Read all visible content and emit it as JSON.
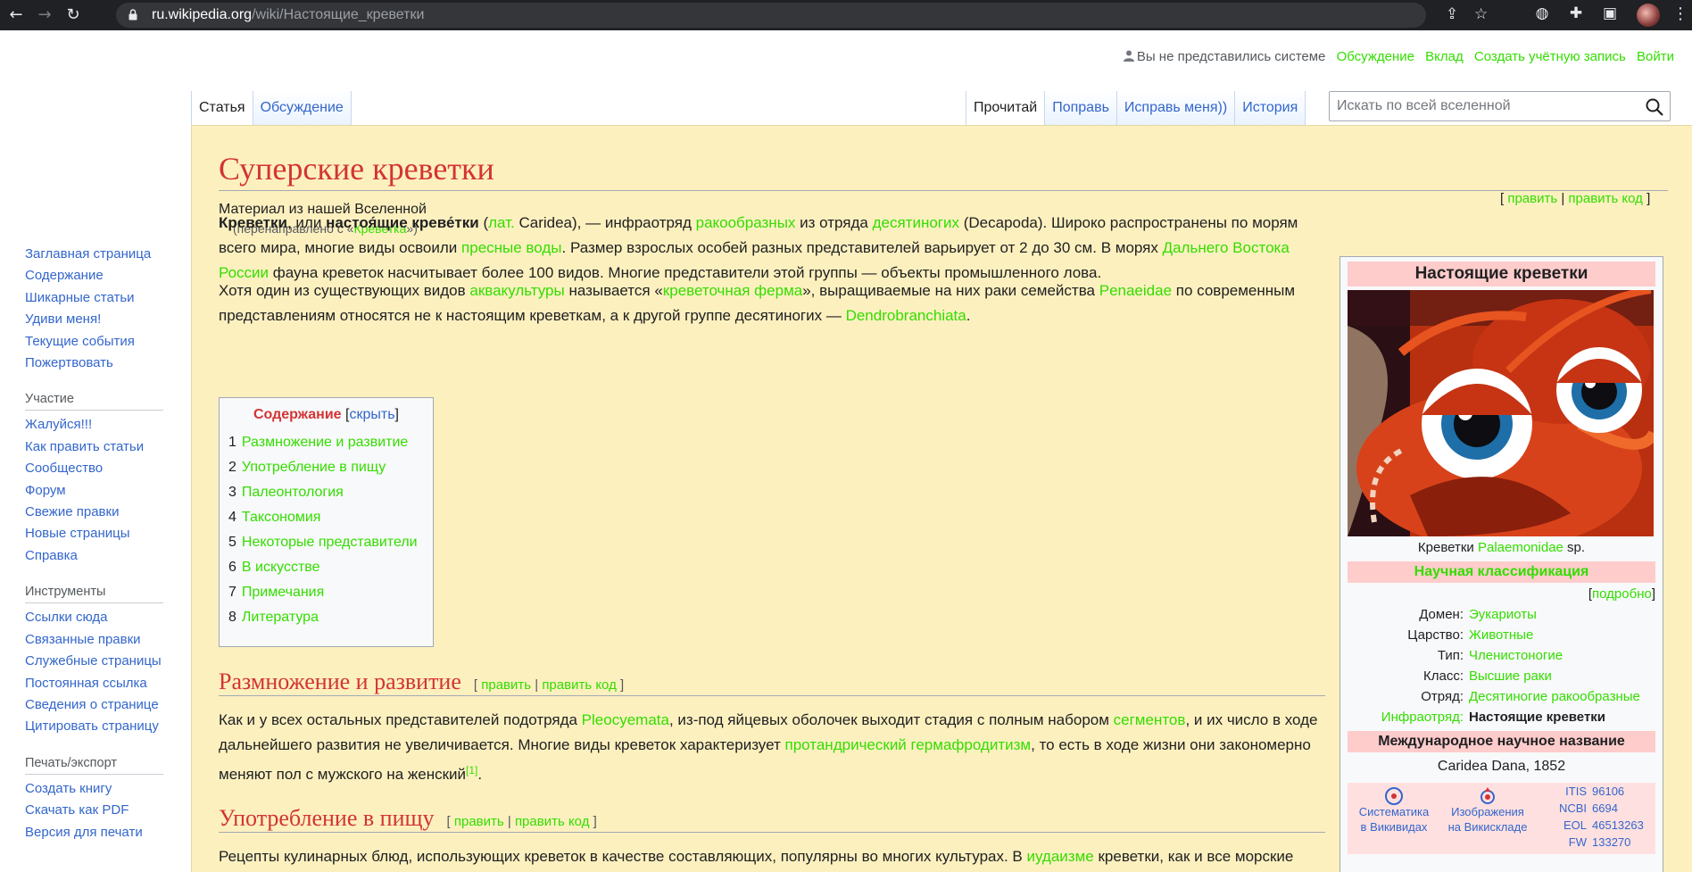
{
  "browser": {
    "url_host": "ru.wikipedia.org",
    "url_path": "/wiki/Настоящие_креветки"
  },
  "personal": {
    "user_status": "Вы не представились системе",
    "talk": "Обсуждение",
    "contributions": "Вклад",
    "create_account": "Создать учётную запись",
    "login": "Войти"
  },
  "tabs": {
    "article": "Статья",
    "talk": "Обсуждение",
    "read": "Прочитай",
    "edit": "Поправь",
    "edit_source": "Исправь меня))",
    "history": "История"
  },
  "search": {
    "placeholder": "Искать по всей вселенной"
  },
  "sidebar": {
    "main": [
      "Заглавная страница",
      "Содержание",
      "Шикарные статьи",
      "Удиви меня!",
      "Текущие события",
      "Пожертвовать"
    ],
    "participation_title": "Участие",
    "participation": [
      "Жалуйся!!!",
      "Как править статьи",
      "Сообщество",
      "Форум",
      "Свежие правки",
      "Новые страницы",
      "Справка"
    ],
    "tools_title": "Инструменты",
    "tools": [
      "Ссылки сюда",
      "Связанные правки",
      "Служебные страницы",
      "Постоянная ссылка",
      "Сведения о странице",
      "Цитировать страницу"
    ],
    "print_title": "Печать/экспорт",
    "print": [
      "Создать книгу",
      "Скачать как PDF",
      "Версия для печати"
    ]
  },
  "article": {
    "title": "Суперские креветки",
    "sitesub": "Материал из нашей Вселенной",
    "redirect_prefix": "(перенаправлено с «",
    "redirect_link": "Креветка",
    "redirect_suffix": "»)",
    "edit_top_open": "[ ",
    "edit_label": "править",
    "sep": " | ",
    "edit_code_label": "править код",
    "edit_top_close": " ]",
    "p1": {
      "b1": "Креветки",
      "t1": ", или ",
      "b2": "настоя́щие креве́тки",
      "t2": " (",
      "l_lat": "лат.",
      "t3": " Caridea), — инфраотряд ",
      "l_crust": "ракообразных",
      "t4": " из отряда ",
      "l_deca": "десятиногих",
      "t5": " (Decapoda). Широко распространены по морям всего мира, многие виды освоили ",
      "l_fresh": "пресные воды",
      "t6": ". Размер взрослых особей разных представителей варьирует от 2 до 30 см. В морях ",
      "l_fe": "Дальнего Востока России",
      "t7": " фауна креветок насчитывает более 100 видов. Многие представители этой группы — объекты промышленного лова."
    },
    "p2": {
      "t1": "Хотя один из существующих видов ",
      "l_aqua": "аквакультуры",
      "t2": " называется «",
      "l_farm": "креветочная ферма",
      "t3": "», выращиваемые на них раки семейства ",
      "l_pen": "Penaeidae",
      "t4": " по современным представлениям относятся не к настоящим креветкам, а к другой группе десятиногих — ",
      "l_den": "Dendrobranchiata",
      "t5": "."
    },
    "toc": {
      "title": "Содержание",
      "hide_open": " [",
      "hide": "скрыть",
      "hide_close": "]",
      "items": [
        {
          "num": "1",
          "label": "Размножение и развитие"
        },
        {
          "num": "2",
          "label": "Употребление в пищу"
        },
        {
          "num": "3",
          "label": "Палеонтология"
        },
        {
          "num": "4",
          "label": "Таксономия"
        },
        {
          "num": "5",
          "label": "Некоторые представители"
        },
        {
          "num": "6",
          "label": "В искусстве"
        },
        {
          "num": "7",
          "label": "Примечания"
        },
        {
          "num": "8",
          "label": "Литература"
        }
      ]
    },
    "s1": {
      "title": "Размножение и развитие",
      "p": {
        "t1": "Как и у всех остальных представителей подотряда ",
        "l_pleo": "Pleocyemata",
        "t2": ", из-под яйцевых оболочек выходит стадия с полным набором ",
        "l_seg": "сегментов",
        "t3": ", и их число в ходе дальнейшего развития не увеличивается. Многие виды креветок характеризует ",
        "l_herm": "протандрический гермафродитизм",
        "t4": ", то есть в ходе жизни они закономерно меняют пол с мужского на женский",
        "ref": "[1]",
        "t5": "."
      }
    },
    "s2": {
      "title": "Употребление в пищу",
      "p": {
        "t1": "Рецепты кулинарных блюд, использующих креветок в качестве составляющих, популярны во многих культурах. В ",
        "l_jud": "иудаизме",
        "t2": " креветки, как и все морские"
      }
    }
  },
  "infobox": {
    "title": "Настоящие креветки",
    "caption_prefix": "Креветки ",
    "caption_link": "Palaemonidae",
    "caption_suffix": " sp.",
    "classification": "Научная классификация",
    "detail_open": "[",
    "detail": "подробно",
    "detail_close": "]",
    "rows": [
      {
        "key": "Домен:",
        "value": "Эукариоты"
      },
      {
        "key": "Царство:",
        "value": "Животные"
      },
      {
        "key": "Тип:",
        "value": "Членистоногие"
      },
      {
        "key": "Класс:",
        "value": "Высшие раки"
      },
      {
        "key": "Отряд:",
        "value": "Десятиногие ракообразные"
      }
    ],
    "infraorder_key": "Инфраотряд:",
    "infraorder_value": "Настоящие креветки",
    "intl_name_title": "Международное научное название",
    "latin_name": "Caridea Dana, 1852",
    "proj1_line1": "Систематика",
    "proj1_line2": "в Викивидах",
    "proj2_line1": "Изображения",
    "proj2_line2": "на Викискладе",
    "ids": [
      {
        "k": "ITIS",
        "v": "96106"
      },
      {
        "k": "NCBI",
        "v": "6694"
      },
      {
        "k": "EOL",
        "v": "46513263"
      },
      {
        "k": "FW",
        "v": "133270"
      }
    ]
  }
}
